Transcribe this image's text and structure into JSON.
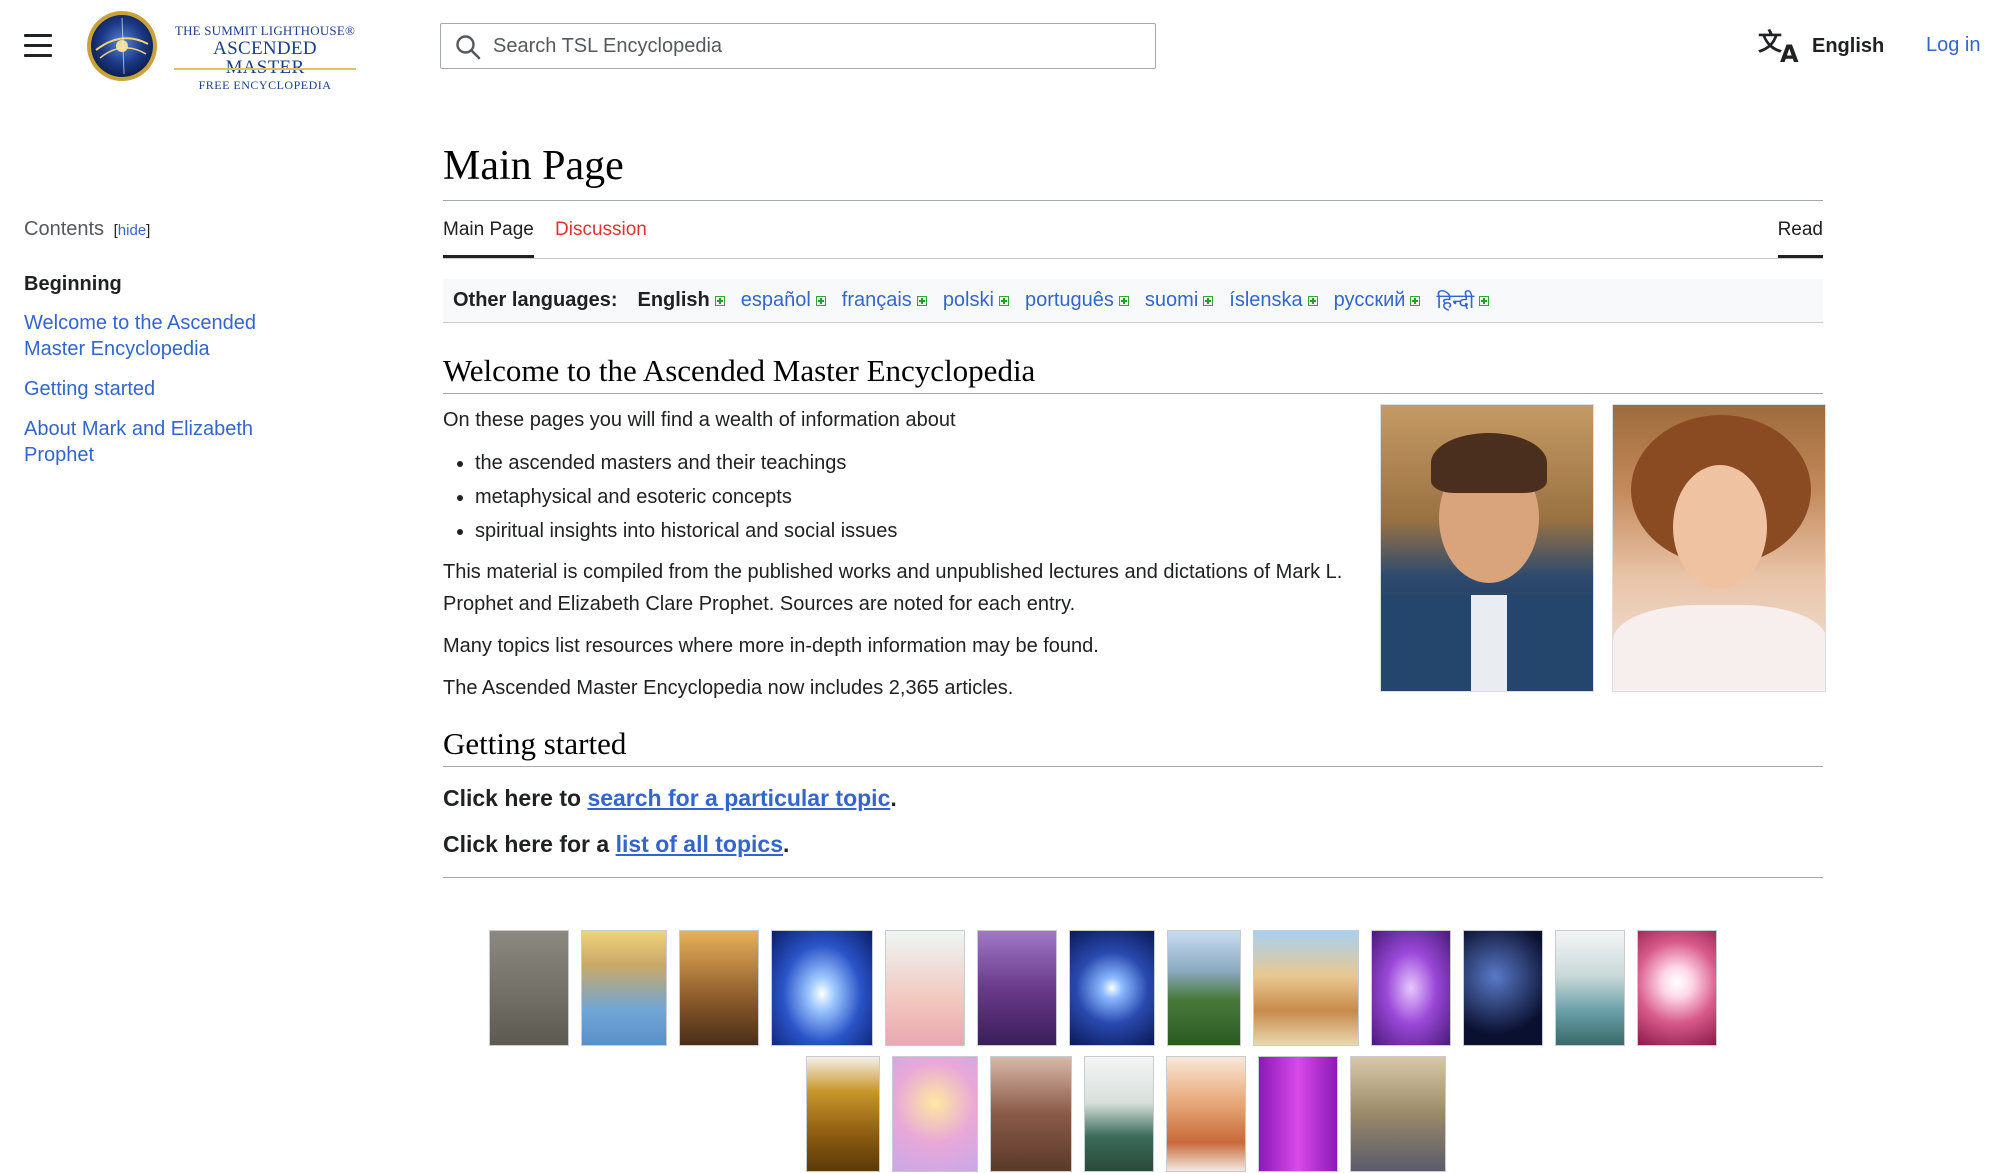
{
  "header": {
    "menu_label": "Main menu",
    "logo": {
      "line1": "THE SUMMIT LIGHTHOUSE®",
      "line2": "ASCENDED MASTER",
      "line3": "FREE ENCYCLOPEDIA"
    },
    "search": {
      "placeholder": "Search TSL Encyclopedia",
      "value": ""
    },
    "language_button": "English",
    "login": "Log in"
  },
  "toc": {
    "heading": "Contents",
    "hide_label": "hide",
    "beginning": "Beginning",
    "items": [
      {
        "label": "Welcome to the Ascended Master Encyclopedia"
      },
      {
        "label": "Getting started"
      },
      {
        "label": "About Mark and Elizabeth Prophet"
      }
    ]
  },
  "page": {
    "title": "Main Page",
    "tabs": {
      "main": "Main Page",
      "discussion": "Discussion",
      "read": "Read"
    },
    "other_languages_label": "Other languages:",
    "languages": [
      {
        "name": "English",
        "current": true
      },
      {
        "name": "español"
      },
      {
        "name": "français"
      },
      {
        "name": "polski"
      },
      {
        "name": "português"
      },
      {
        "name": "suomi"
      },
      {
        "name": "íslenska"
      },
      {
        "name": "русский"
      },
      {
        "name": "हिन्दी"
      }
    ]
  },
  "welcome": {
    "heading": "Welcome to the Ascended Master Encyclopedia",
    "intro": "On these pages you will find a wealth of information about",
    "bullets": [
      "the ascended masters and their teachings",
      "metaphysical and esoteric concepts",
      "spiritual insights into historical and social issues"
    ],
    "p1": "This material is compiled from the published works and unpublished lectures and dictations of Mark L. Prophet and Elizabeth Clare Prophet. Sources are noted for each entry.",
    "p2": "Many topics list resources where more in-depth information may be found.",
    "p3": "The Ascended Master Encyclopedia now includes 2,365 articles."
  },
  "getting_started": {
    "heading": "Getting started",
    "line1_prefix": "Click here to ",
    "line1_link": "search for a particular topic",
    "line1_suffix": ".",
    "line2_prefix": "Click here for a ",
    "line2_link": "list of all topics",
    "line2_suffix": "."
  },
  "colors": {
    "link": "#3366cc",
    "text": "#202122",
    "new_link": "#d33"
  }
}
